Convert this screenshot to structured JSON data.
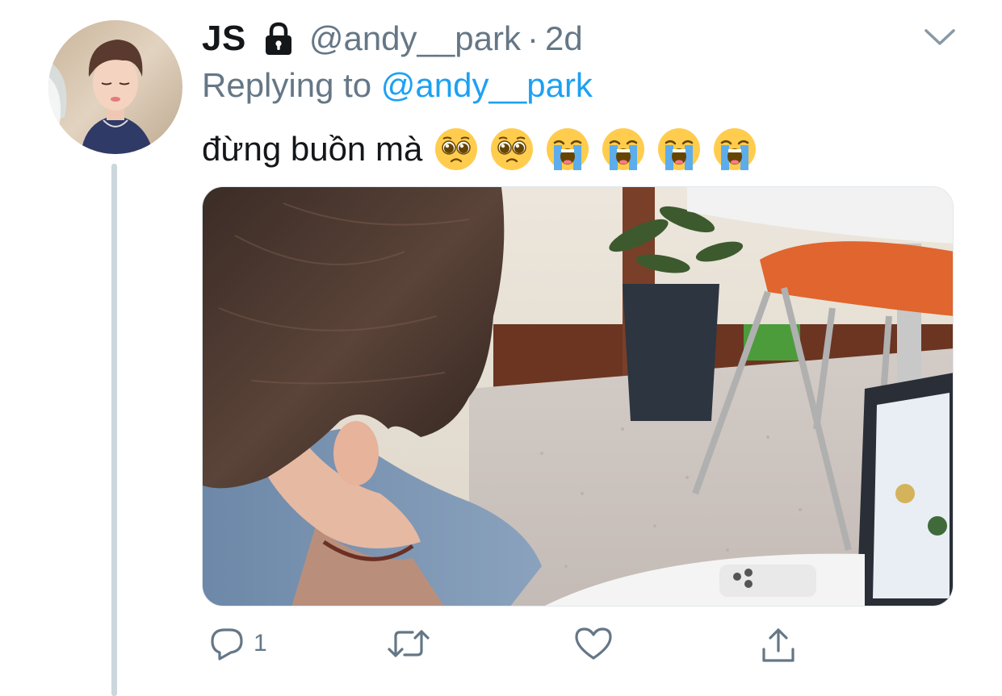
{
  "tweet": {
    "display_name": "JS",
    "handle": "@andy__park",
    "separator": "·",
    "timestamp": "2d",
    "replying_prefix": "Replying to",
    "replying_to": "@andy__park",
    "text": "đừng buồn mà",
    "emojis": [
      "pleading-face",
      "pleading-face",
      "loudly-crying-face",
      "loudly-crying-face",
      "loudly-crying-face",
      "loudly-crying-face"
    ],
    "account_protected": true
  },
  "actions": {
    "reply_count": "1",
    "retweet_count": "",
    "like_count": ""
  },
  "colors": {
    "text_primary": "#14171a",
    "text_secondary": "#657786",
    "mention_blue": "#1da1f2",
    "thread_line": "#ccd6dd",
    "emoji_yellow": "#ffcc4d",
    "tear_blue": "#5dadec"
  }
}
